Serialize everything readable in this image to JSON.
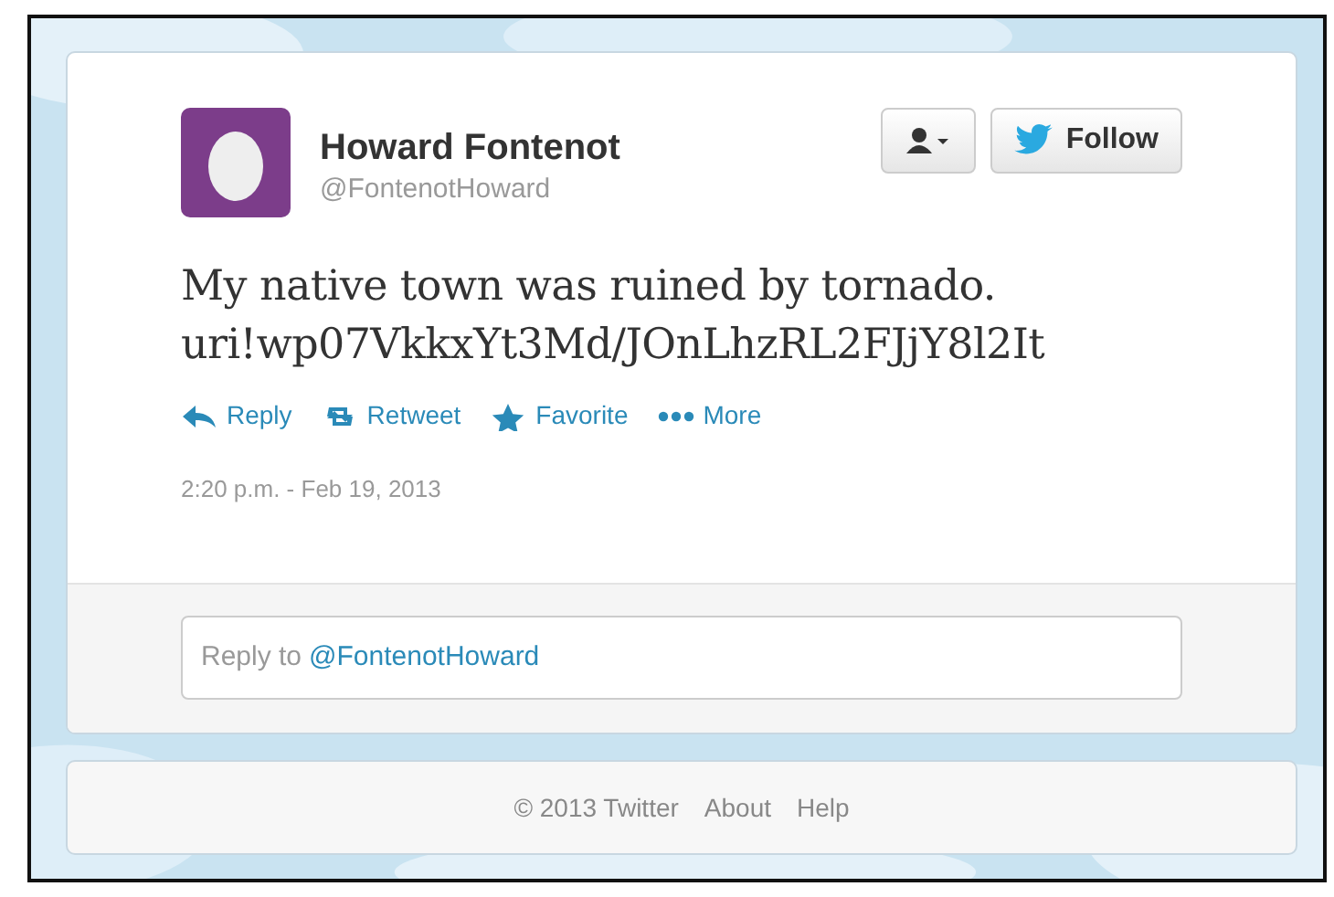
{
  "tweet": {
    "name": "Howard Fontenot",
    "handle": "@FontenotHoward",
    "follow_button": "Follow",
    "text_lines": [
      "My native town was ruined by tornado.",
      "uri!wp07VkkxYt3Md/JOnLhzRL2FJjY8l2It"
    ],
    "actions": [
      {
        "kind": "reply",
        "label": "Reply"
      },
      {
        "kind": "retweet",
        "label": "Retweet"
      },
      {
        "kind": "favorite",
        "label": "Favorite"
      },
      {
        "kind": "more",
        "label": "More"
      }
    ],
    "timestamp": "2:20 p.m. - Feb 19, 2013"
  },
  "reply_box": {
    "prefix": "Reply to",
    "mention": "@FontenotHoward"
  },
  "footer": [
    "© 2013 Twitter",
    "About",
    "Help"
  ]
}
